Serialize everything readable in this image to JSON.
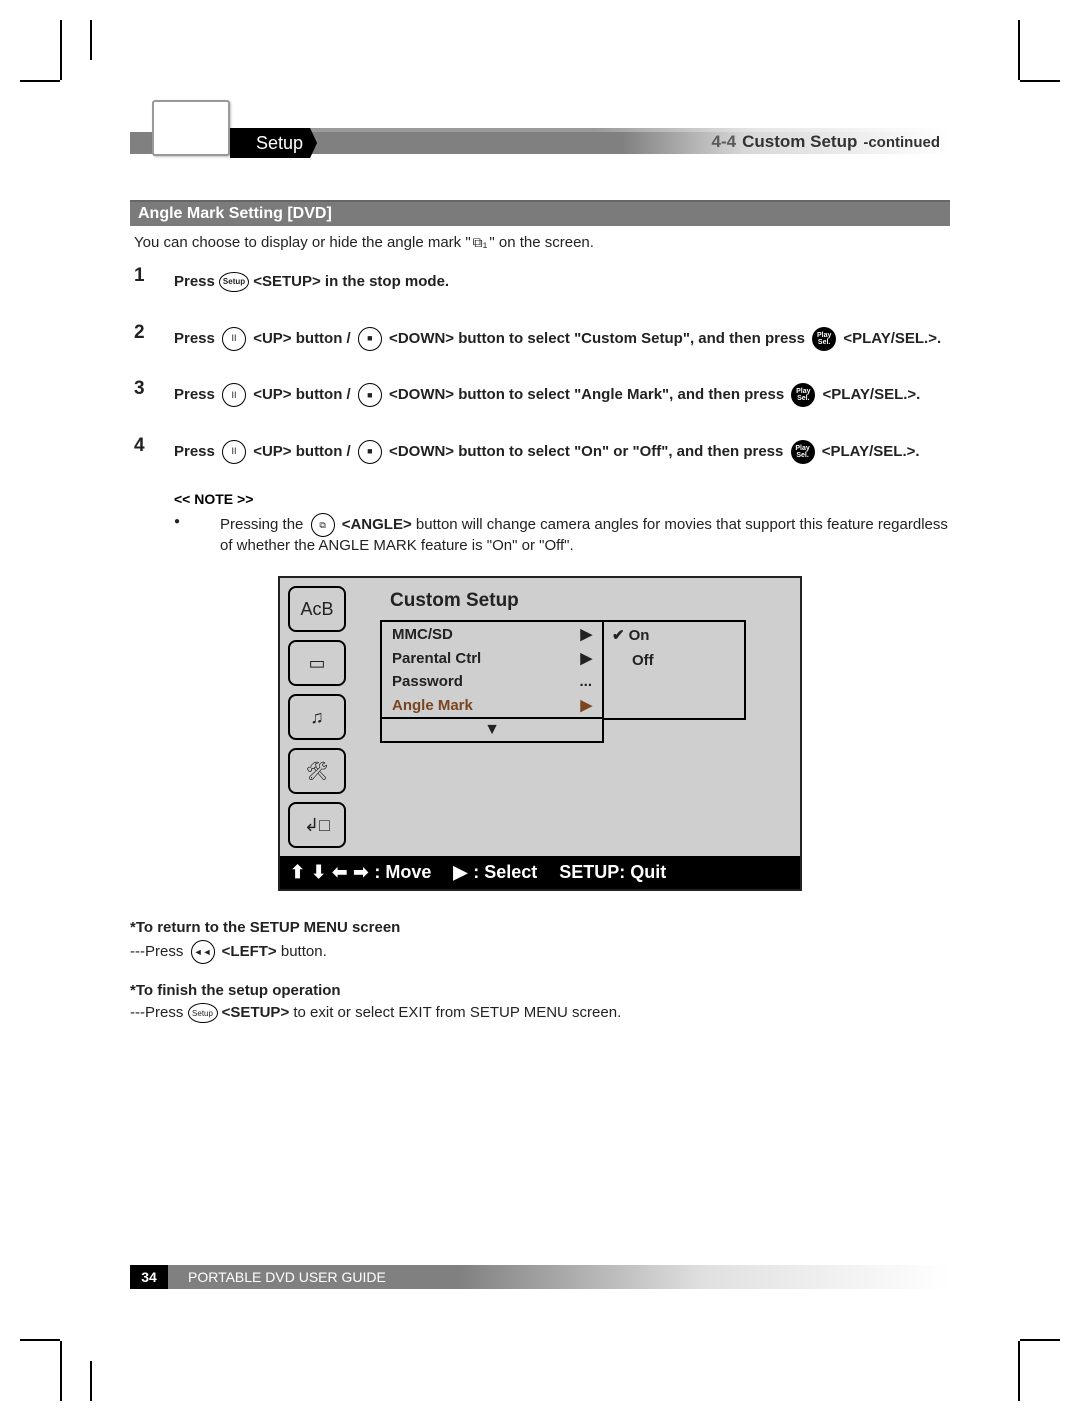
{
  "header": {
    "breadcrumb": "Setup",
    "chapter_number": "4-4",
    "chapter_title": "Custom Setup",
    "chapter_suffix": "-continued"
  },
  "section_title": "Angle Mark Setting [DVD]",
  "intro_pre": "You can choose to display or hide the angle mark \"",
  "intro_glyph": "⧉₁",
  "intro_post": "\" on the screen.",
  "steps": [
    {
      "n": "1",
      "parts": [
        "Press ",
        {
          "btn": "Setup",
          "t": "pill"
        },
        " <SETUP> in the stop mode."
      ]
    },
    {
      "n": "2",
      "parts": [
        "Press ",
        {
          "btn": "II",
          "t": "circle"
        },
        " <UP> button / ",
        {
          "btn": "■",
          "t": "circle"
        },
        " <DOWN> button to select \"Custom Setup\", and then press ",
        {
          "btn": "Play Sel.",
          "t": "dark"
        },
        " <PLAY/SEL.>."
      ]
    },
    {
      "n": "3",
      "parts": [
        "Press ",
        {
          "btn": "II",
          "t": "circle"
        },
        " <UP> button / ",
        {
          "btn": "■",
          "t": "circle"
        },
        " <DOWN> button to select \"Angle Mark\", and then press ",
        {
          "btn": "Play Sel.",
          "t": "dark"
        },
        " <PLAY/SEL.>."
      ]
    },
    {
      "n": "4",
      "parts": [
        "Press ",
        {
          "btn": "II",
          "t": "circle"
        },
        " <UP> button / ",
        {
          "btn": "■",
          "t": "circle"
        },
        " <DOWN> button to select \"On\" or \"Off\", and then press ",
        {
          "btn": "Play Sel.",
          "t": "dark"
        },
        " <PLAY/SEL.>."
      ]
    }
  ],
  "note_title": "<< NOTE >>",
  "note_body_pre": "Pressing the ",
  "note_btn": "⧉",
  "note_bold": "<ANGLE>",
  "note_body_post": " button will change camera angles for movies that support this feature regardless of whether the ANGLE MARK feature is \"On\" or \"Off\".",
  "osd": {
    "title": "Custom Setup",
    "sidebar_icons": [
      "AᴄB",
      "▭",
      "♫",
      "🛠",
      "↲□"
    ],
    "menu": [
      {
        "label": "MMC/SD",
        "hint": "▶"
      },
      {
        "label": "Parental Ctrl",
        "hint": "▶"
      },
      {
        "label": "Password",
        "hint": "..."
      },
      {
        "label": "Angle Mark",
        "hint": "▶",
        "selected": true
      }
    ],
    "down_hint": "▼",
    "options": [
      {
        "label": "On",
        "checked": true
      },
      {
        "label": "Off",
        "checked": false
      }
    ],
    "bottom": {
      "move": ": Move",
      "select": ": Select",
      "quit": "SETUP: Quit"
    }
  },
  "post": {
    "return_title": "*To return to the SETUP MENU screen",
    "return_text_pre": "---Press ",
    "return_btn": "◄◄",
    "return_bold": "<LEFT>",
    "return_text_post": " button.",
    "finish_title": "*To finish the setup operation",
    "finish_text_pre": "---Press ",
    "finish_btn": "Setup",
    "finish_bold": "<SETUP>",
    "finish_text_post": " to exit or select EXIT from SETUP MENU screen."
  },
  "footer": {
    "page": "34",
    "text": "PORTABLE DVD USER GUIDE"
  }
}
